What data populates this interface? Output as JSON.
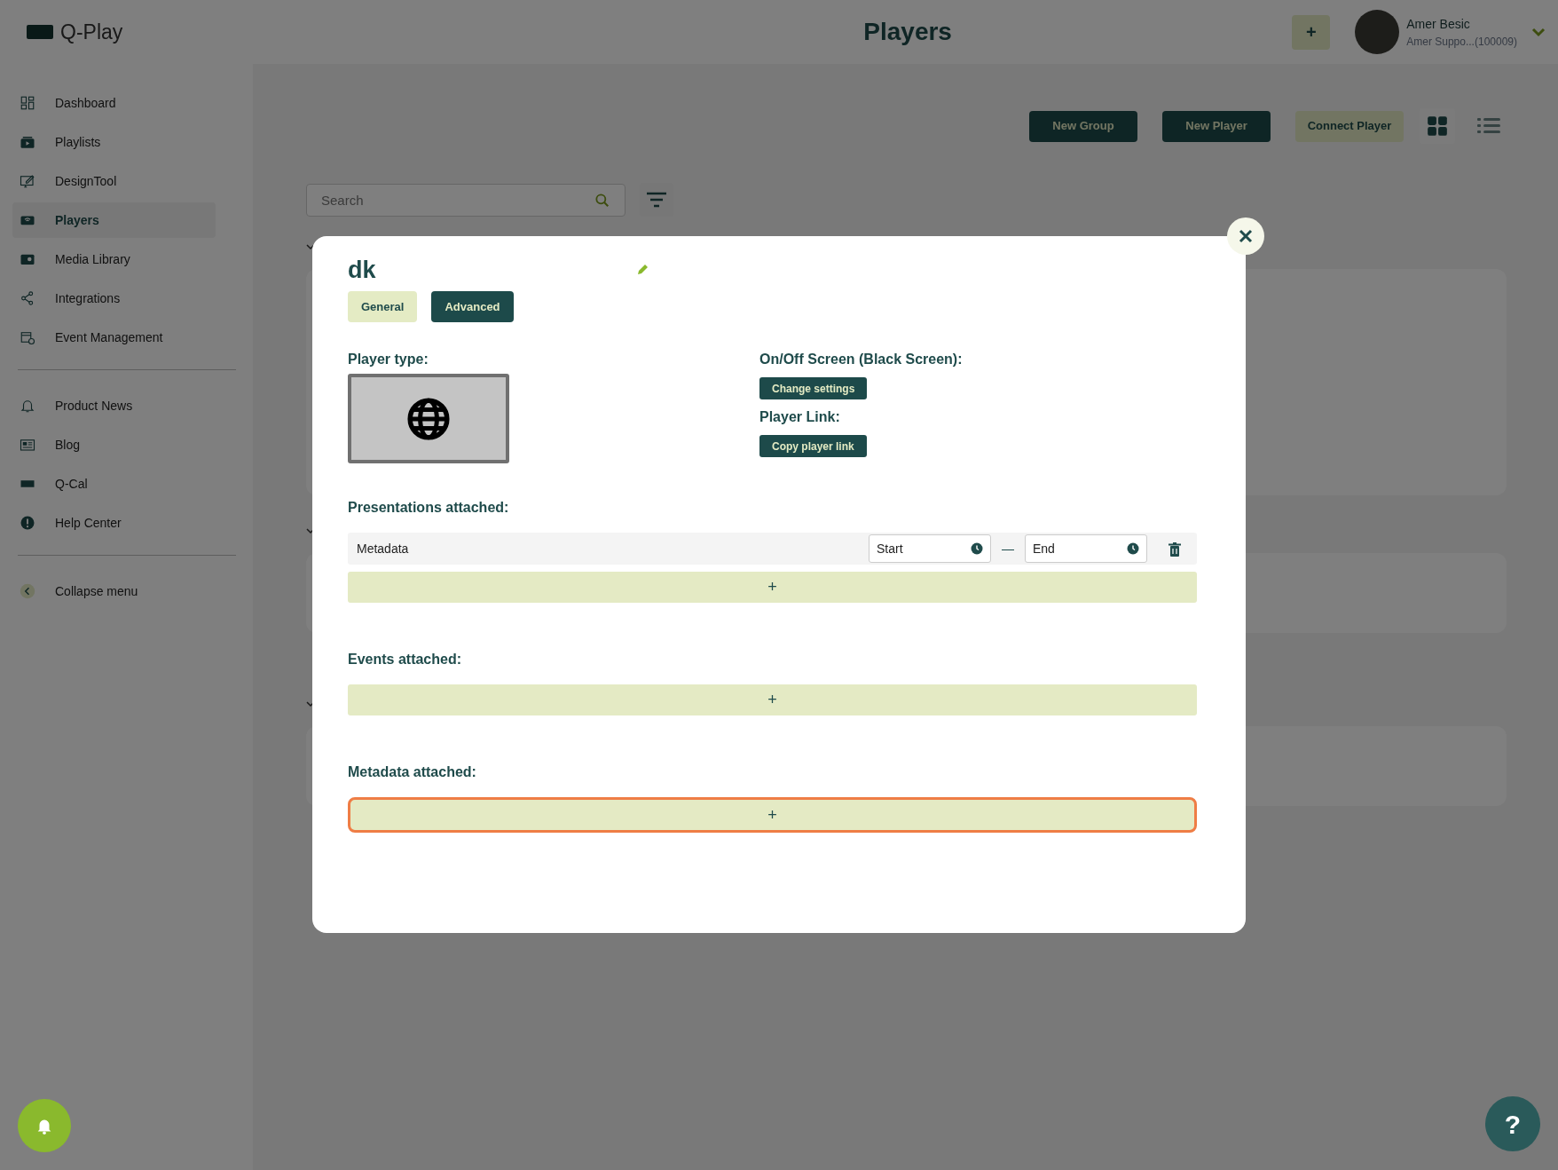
{
  "app": {
    "logo_text": "Q-Play"
  },
  "header": {
    "title": "Players",
    "add_label": "+",
    "user": {
      "name": "Amer Besic",
      "account": "Amer Suppo...(100009)"
    }
  },
  "sidebar": {
    "groups": [
      [
        {
          "label": "Dashboard",
          "selected": false
        },
        {
          "label": "Playlists",
          "selected": false
        },
        {
          "label": "DesignTool",
          "selected": false
        },
        {
          "label": "Players",
          "selected": true
        },
        {
          "label": "Media Library",
          "selected": false
        },
        {
          "label": "Integrations",
          "selected": false
        },
        {
          "label": "Event Management",
          "selected": false
        }
      ],
      [
        {
          "label": "Product News",
          "selected": false
        },
        {
          "label": "Blog",
          "selected": false
        },
        {
          "label": "Q-Cal",
          "selected": false
        },
        {
          "label": "Help Center",
          "selected": false
        }
      ],
      [
        {
          "label": "Collapse menu",
          "selected": false
        }
      ]
    ]
  },
  "toolbar": {
    "buttons": [
      {
        "label": "New Group",
        "kind": "dark"
      },
      {
        "label": "New Player",
        "kind": "dark"
      },
      {
        "label": "Connect Player",
        "kind": "light"
      }
    ],
    "views": [
      {
        "kind": "grid",
        "selected": true
      },
      {
        "kind": "list",
        "selected": false
      }
    ]
  },
  "search": {
    "placeholder": "Search"
  },
  "modal": {
    "title": "dk",
    "tabs": [
      {
        "label": "General",
        "selected": false
      },
      {
        "label": "Advanced",
        "selected": true
      }
    ],
    "player_type_label": "Player type:",
    "screen_label": "On/Off Screen (Black Screen):",
    "change_settings": "Change settings",
    "link_label": "Player Link:",
    "copy_link": "Copy player link",
    "sections": [
      {
        "title": "Presentations attached:",
        "rows": [
          {
            "name": "Metadata",
            "start": "Start",
            "separator": "—",
            "end": "End"
          }
        ],
        "add": "+",
        "focused": false
      },
      {
        "title": "Events attached:",
        "add": "+",
        "focused": false
      },
      {
        "title": "Metadata attached:",
        "add": "+",
        "focused": true
      }
    ]
  },
  "help_label": "?"
}
